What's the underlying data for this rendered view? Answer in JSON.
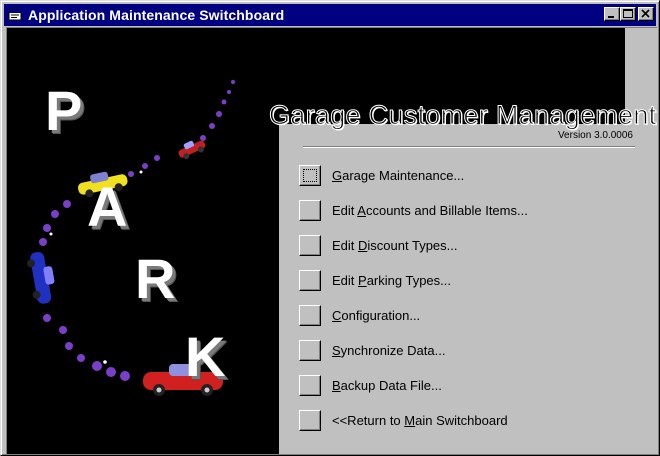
{
  "window": {
    "title": "Application Maintenance Switchboard",
    "controls": {
      "minimize": "minimize-icon",
      "maximize": "maximize-icon",
      "close": "close-icon"
    }
  },
  "logo": {
    "letters": [
      "P",
      "A",
      "R",
      "K"
    ]
  },
  "header": {
    "app_title": "Garage Customer Management",
    "version": "Version 3.0.0006"
  },
  "menu": [
    {
      "pre": "",
      "key": "G",
      "post": "arage Maintenance...",
      "focused": true
    },
    {
      "pre": "Edit ",
      "key": "A",
      "post": "ccounts and Billable Items...",
      "focused": false
    },
    {
      "pre": "Edit ",
      "key": "D",
      "post": "iscount Types...",
      "focused": false
    },
    {
      "pre": "Edit ",
      "key": "P",
      "post": "arking Types...",
      "focused": false
    },
    {
      "pre": "",
      "key": "C",
      "post": "onfiguration...",
      "focused": false
    },
    {
      "pre": "",
      "key": "S",
      "post": "ynchronize Data...",
      "focused": false
    },
    {
      "pre": "",
      "key": "B",
      "post": "ackup Data File...",
      "focused": false
    },
    {
      "pre": "<<Return to ",
      "key": "M",
      "post": "ain Switchboard",
      "focused": false
    }
  ],
  "colors": {
    "titlebar": "#000080",
    "face": "#c0c0c0",
    "logo_bg": "#000000"
  }
}
